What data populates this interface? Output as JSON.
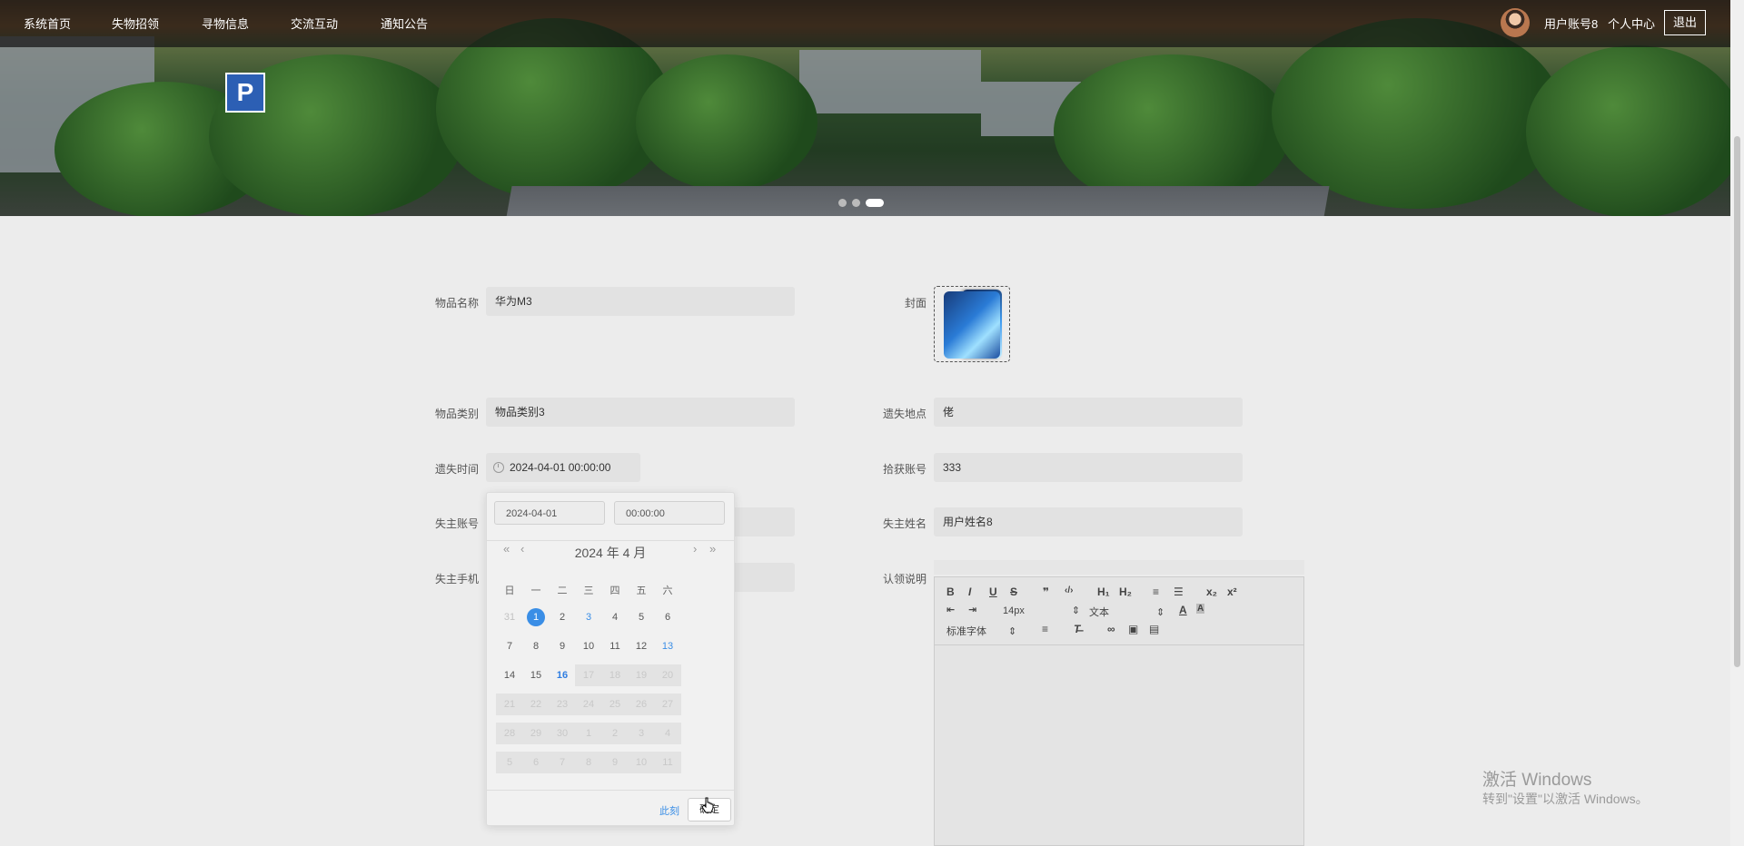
{
  "nav": {
    "items": [
      "系统首页",
      "失物招领",
      "寻物信息",
      "交流互动",
      "通知公告"
    ],
    "user_name": "用户账号8",
    "user_center": "个人中心",
    "logout": "退出"
  },
  "carousel": {
    "count": 3,
    "active_index": 2
  },
  "form": {
    "item_name_label": "物品名称",
    "item_name": "华为M3",
    "cover_label": "封面",
    "category_label": "物品类别",
    "category": "物品类别3",
    "lost_place_label": "遗失地点",
    "lost_place": "佬",
    "lost_time_label": "遗失时间",
    "lost_time": "2024-04-01 00:00:00",
    "finder_account_label": "拾获账号",
    "finder_account": "333",
    "owner_account_label": "失主账号",
    "owner_name_label": "失主姓名",
    "owner_name": "用户姓名8",
    "owner_phone_label": "失主手机",
    "claim_desc_label": "认领说明"
  },
  "datepicker": {
    "date_value": "2024-04-01",
    "time_value": "00:00:00",
    "title": "2024 年  4 月",
    "weekdays": [
      "日",
      "一",
      "二",
      "三",
      "四",
      "五",
      "六"
    ],
    "rows": [
      [
        "31",
        "1",
        "2",
        "3",
        "4",
        "5",
        "6"
      ],
      [
        "7",
        "8",
        "9",
        "10",
        "11",
        "12",
        "13"
      ],
      [
        "14",
        "15",
        "16",
        "17",
        "18",
        "19",
        "20"
      ],
      [
        "21",
        "22",
        "23",
        "24",
        "25",
        "26",
        "27"
      ],
      [
        "28",
        "29",
        "30",
        "1",
        "2",
        "3",
        "4"
      ],
      [
        "5",
        "6",
        "7",
        "8",
        "9",
        "10",
        "11"
      ]
    ],
    "now_label": "此刻",
    "ok_label": "确定"
  },
  "editor": {
    "font_size": "14px",
    "block_format": "文本",
    "font_family": "标准字体",
    "buttons": [
      "B",
      "I",
      "U",
      "S",
      "❞",
      "‹/›",
      "H₁",
      "H₂",
      "≡",
      "☰",
      "x₂",
      "x²"
    ]
  },
  "watermark": {
    "line1": "激活 Windows",
    "line2": "转到\"设置\"以激活 Windows。"
  }
}
